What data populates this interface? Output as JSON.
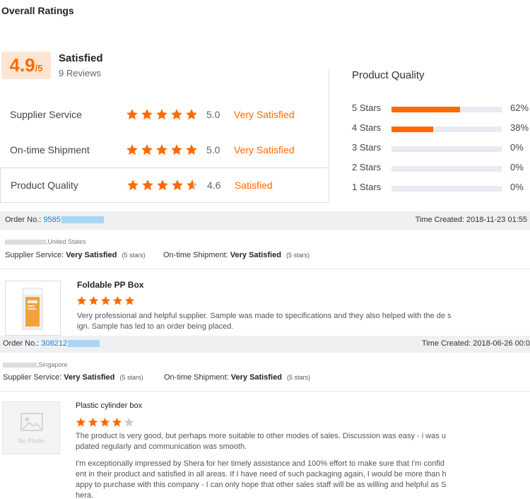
{
  "header": {
    "title": "Overall Ratings"
  },
  "summary": {
    "score": "4.9",
    "out_of": "/5",
    "level": "Satisfied",
    "reviews": "9 Reviews"
  },
  "ratings": [
    {
      "label": "Supplier Service",
      "stars": 5,
      "score": "5.0",
      "text": "Very Satisfied"
    },
    {
      "label": "On-time Shipment",
      "stars": 5,
      "score": "5.0",
      "text": "Very Satisfied"
    },
    {
      "label": "Product Quality",
      "stars": 4.6,
      "score": "4.6",
      "text": "Satisfied"
    }
  ],
  "product_quality": {
    "title": "Product Quality",
    "bars": [
      {
        "label": "5  Stars",
        "percent": 62,
        "pct_text": "62%"
      },
      {
        "label": "4  Stars",
        "percent": 38,
        "pct_text": "38%"
      },
      {
        "label": "3  Stars",
        "percent": 0,
        "pct_text": "0%"
      },
      {
        "label": "2  Stars",
        "percent": 0,
        "pct_text": "0%"
      },
      {
        "label": "1  Stars",
        "percent": 0,
        "pct_text": "0%"
      }
    ]
  },
  "orders": [
    {
      "order_label": "Order No.:",
      "order_no": "9585",
      "time_label": "Time Created:",
      "time": "2018-11-23 01:55",
      "location": ",United States",
      "supplier_service_label": "Supplier Service:",
      "supplier_service_value": "Very Satisfied",
      "supplier_service_stars": "(5 stars)",
      "shipment_label": "On-time Shipment:",
      "shipment_value": "Very Satisfied",
      "shipment_stars": "(5 stars)",
      "product_name": "Foldable PP Box",
      "product_stars": 5,
      "review_1": "Very professional and helpful supplier. Sample was made to specifications and they also helped with the de sign. Sample has led to an order being placed.",
      "review_2": ""
    },
    {
      "order_label": "Order No.:",
      "order_no": "308212",
      "time_label": "Time Created:",
      "time": "2018-06-26 00:0",
      "location": ",Singapore",
      "supplier_service_label": "Supplier Service:",
      "supplier_service_value": "Very Satisfied",
      "supplier_service_stars": "(5 stars)",
      "shipment_label": "On-time Shipment:",
      "shipment_value": "Very Satisfied",
      "shipment_stars": "(5 stars)",
      "product_name": "Plastic cylinder box",
      "product_stars": 4,
      "no_photo": "No Photo",
      "review_1": "The product is very good, but perhaps more suitable to other modes of sales. Discussion was easy - i was u pdated regularly and communication was smooth.",
      "review_2": "I'm exceptionally impressed by Shera for her timely assistance and 100% effort to make sure that I'm confid ent in their product and satisfied in all areas. If I have need of such packaging again, I would be more than h appy to purchase with this company - I can only hope that other sales staff will be as willing and helpful as Shera."
    }
  ],
  "colors": {
    "accent": "#ff6a00",
    "link": "#1a7fd1",
    "track": "#e8ebf0",
    "bar_bg": "#eef0f2",
    "star_empty": "#cccccc"
  }
}
